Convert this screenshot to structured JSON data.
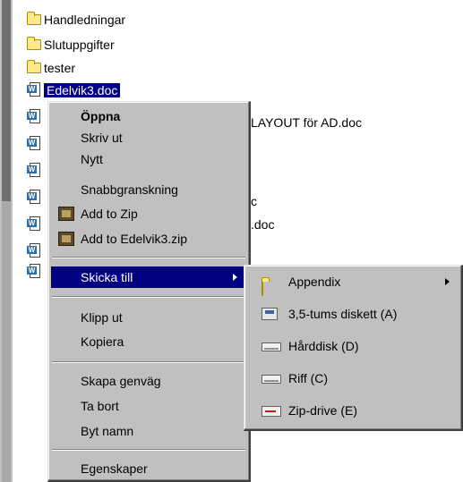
{
  "colors": {
    "highlight": "#000080",
    "menu_bg": "#c0c0c0",
    "folder": "#ffe98a"
  },
  "files": [
    {
      "name": "Handledningar",
      "icon": "folder-icon"
    },
    {
      "name": "Slutuppgifter",
      "icon": "folder-icon"
    },
    {
      "name": "tester",
      "icon": "folder-icon"
    },
    {
      "name": "Edelvik3.doc",
      "icon": "word-doc-icon",
      "selected": true
    }
  ],
  "partial_names": {
    "row1": "LAYOUT för AD.doc",
    "row2": "c",
    "row3": ".doc"
  },
  "context_menu": {
    "open": "Öppna",
    "print": "Skriv ut",
    "new": "Nytt",
    "quick_view": "Snabbgranskning",
    "add_to_zip": "Add to Zip",
    "add_to_named_zip": "Add to Edelvik3.zip",
    "send_to": "Skicka till",
    "cut": "Klipp ut",
    "copy": "Kopiera",
    "create_shortcut": "Skapa genväg",
    "delete": "Ta bort",
    "rename": "Byt namn",
    "properties": "Egenskaper"
  },
  "send_to_menu": {
    "appendix": "Appendix",
    "floppy": "3,5-tums diskett (A)",
    "hard_disk": "Hårddisk (D)",
    "riff": "Riff (C)",
    "zip_drive": "Zip-drive (E)"
  }
}
